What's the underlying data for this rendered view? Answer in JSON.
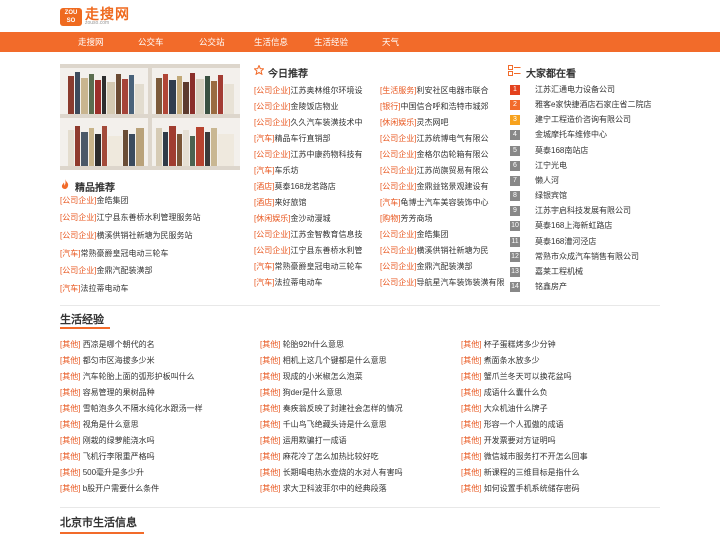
{
  "brand": {
    "name": "走搜网",
    "domain": "zouso.com",
    "badge": "ZOU SO"
  },
  "nav": [
    "走搜网",
    "公交车",
    "公交站",
    "生活信息",
    "生活经验",
    "天气"
  ],
  "jingpin": {
    "title": "精品推荐",
    "items": [
      {
        "tag": "[公司企业]",
        "text": "金皓集团"
      },
      {
        "tag": "[公司企业]",
        "text": "江宁县东善桥水利管理服务站"
      },
      {
        "tag": "[公司企业]",
        "text": "横溪供销社新塘为民服务站"
      },
      {
        "tag": "[汽车]",
        "text": "常熟豪爵皇冠电动三轮车"
      },
      {
        "tag": "[公司企业]",
        "text": "金鼎汽配装潢部"
      },
      {
        "tag": "[汽车]",
        "text": "法拉蒂电动车"
      }
    ]
  },
  "today": {
    "title": "今日推荐",
    "col1": [
      {
        "tag": "[公司企业]",
        "text": "江苏奥林维尔环境设"
      },
      {
        "tag": "[公司企业]",
        "text": "金陵饭店物业"
      },
      {
        "tag": "[公司企业]",
        "text": "久久汽车装潢技术中"
      },
      {
        "tag": "[汽车]",
        "text": "精品车行直销部"
      },
      {
        "tag": "[公司企业]",
        "text": "江苏中康药物科技有"
      },
      {
        "tag": "[汽车]",
        "text": "车乐坊"
      },
      {
        "tag": "[酒店]",
        "text": "莫泰168龙茗路店"
      },
      {
        "tag": "[酒店]",
        "text": "来好旅馆"
      },
      {
        "tag": "[休闲娱乐]",
        "text": "金沙动漫城"
      },
      {
        "tag": "[公司企业]",
        "text": "江苏金智教育信息技"
      },
      {
        "tag": "[公司企业]",
        "text": "江宁县东善桥水利管"
      },
      {
        "tag": "[汽车]",
        "text": "常熟豪爵皇冠电动三轮车"
      },
      {
        "tag": "[汽车]",
        "text": "法拉蒂电动车"
      }
    ],
    "col2": [
      {
        "tag": "[生活服务]",
        "text": "利安社区电器市联合"
      },
      {
        "tag": "[银行]",
        "text": "中国信合呼和浩特市城郊"
      },
      {
        "tag": "[休闲娱乐]",
        "text": "灵杰网吧"
      },
      {
        "tag": "[公司企业]",
        "text": "江苏统博电气有限公"
      },
      {
        "tag": "[公司企业]",
        "text": "金格尔齿轮箱有限公"
      },
      {
        "tag": "[公司企业]",
        "text": "江苏尚旗贸易有限公"
      },
      {
        "tag": "[公司企业]",
        "text": "金鼎益铭景观建设有"
      },
      {
        "tag": "[汽车]",
        "text": "龟博士汽车美容装饰中心"
      },
      {
        "tag": "[购物]",
        "text": "芳芳商场"
      },
      {
        "tag": "[公司企业]",
        "text": "金皓集团"
      },
      {
        "tag": "[公司企业]",
        "text": "横溪供销社新塘为民"
      },
      {
        "tag": "[公司企业]",
        "text": "金鼎汽配装潢部"
      },
      {
        "tag": "[公司企业]",
        "text": "导航星汽车装饰装潢有限"
      }
    ]
  },
  "watching": {
    "title": "大家都在看",
    "items": [
      "江苏汇通电力设备公司",
      "雅客e家快捷酒店石家庄省二院店",
      "建宁工程造价咨询有限公司",
      "金城摩托车维修中心",
      "莫泰168南站店",
      "江宁光电",
      "懒人河",
      "绿银宾馆",
      "江苏宇启科技发展有限公司",
      "莫泰168上海新虹路店",
      "莫泰168漕河泾店",
      "常熟市众成汽车销售有限公司",
      "嘉莱工程机械",
      "铭鑫房产"
    ],
    "rank_colors": [
      "#e3421e",
      "#f26b2a",
      "#f7a21d",
      "#888888"
    ]
  },
  "experience": {
    "title": "生活经验",
    "col1": [
      {
        "tag": "[其他]",
        "text": "西凉是哪个朝代的名"
      },
      {
        "tag": "[其他]",
        "text": "都匀市区海拔多少米"
      },
      {
        "tag": "[其他]",
        "text": "汽车轮胎上面的弧形护板叫什么"
      },
      {
        "tag": "[其他]",
        "text": "容易管理的果树品种"
      },
      {
        "tag": "[其他]",
        "text": "雪帕泡多久不隔水纯化水跟汤一样"
      },
      {
        "tag": "[其他]",
        "text": "视角是什么意思"
      },
      {
        "tag": "[其他]",
        "text": "刚栽的绿萝能浇水吗"
      },
      {
        "tag": "[其他]",
        "text": "飞机行李限重严格吗"
      },
      {
        "tag": "[其他]",
        "text": "500毫升是多少升"
      },
      {
        "tag": "[其他]",
        "text": "b股开户需要什么条件"
      }
    ],
    "col2": [
      {
        "tag": "[其他]",
        "text": "轮胎92h什么意思"
      },
      {
        "tag": "[其他]",
        "text": "相机上这几个键都是什么意思"
      },
      {
        "tag": "[其他]",
        "text": "现成的小米椒怎么泡菜"
      },
      {
        "tag": "[其他]",
        "text": "狗der是什么意思"
      },
      {
        "tag": "[其他]",
        "text": "奏疾翁反映了封建社会怎样的情况"
      },
      {
        "tag": "[其他]",
        "text": "千山鸟飞绝藏头诗是什么意思"
      },
      {
        "tag": "[其他]",
        "text": "运用欺骗打一成语"
      },
      {
        "tag": "[其他]",
        "text": "麻花冷了怎么加热比较好吃"
      },
      {
        "tag": "[其他]",
        "text": "长期喝电热水壶烧的水对人有害吗"
      },
      {
        "tag": "[其他]",
        "text": "求大卫科波菲尔中的经典段落"
      }
    ],
    "col3": [
      {
        "tag": "[其他]",
        "text": "杯子蛋糕烤多少分钟"
      },
      {
        "tag": "[其他]",
        "text": "煮面条水放多少"
      },
      {
        "tag": "[其他]",
        "text": "蟹爪兰冬天可以换花盆吗"
      },
      {
        "tag": "[其他]",
        "text": "成语什么囊什么负"
      },
      {
        "tag": "[其他]",
        "text": "大众机油什么牌子"
      },
      {
        "tag": "[其他]",
        "text": "形容一个人孤傲的成语"
      },
      {
        "tag": "[其他]",
        "text": "开发票要对方证明吗"
      },
      {
        "tag": "[其他]",
        "text": "微信城市服务打不开怎么回事"
      },
      {
        "tag": "[其他]",
        "text": "新课程的三维目标是指什么"
      },
      {
        "tag": "[其他]",
        "text": "如何设置手机系统储存密码"
      }
    ]
  },
  "beijing": {
    "title": "北京市生活信息"
  }
}
